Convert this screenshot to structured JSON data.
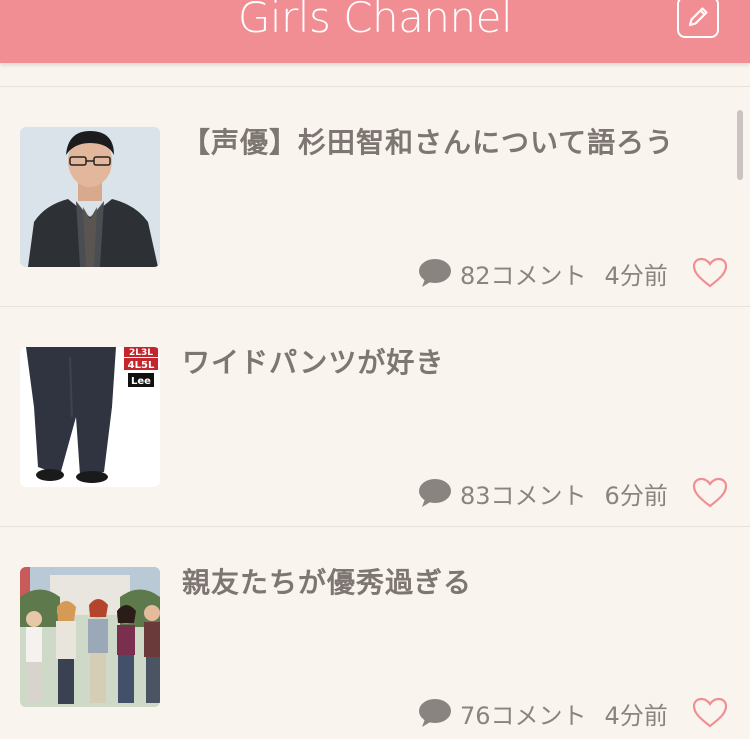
{
  "header": {
    "title": "Girls Channel",
    "edit_icon": "pencil-square-icon"
  },
  "colors": {
    "header_bg": "#f08e93",
    "page_bg": "#faf4ee",
    "title_text": "#7d7672",
    "heart": "#f08e93"
  },
  "topics": [
    {
      "title": "【声優】杉田智和さんについて語ろう",
      "comments": "82コメント",
      "time": "4分前",
      "thumb": "man-in-suit-photo"
    },
    {
      "title": "ワイドパンツが好き",
      "comments": "83コメント",
      "time": "6分前",
      "thumb": "wide-pants-photo",
      "thumb_labels": [
        "2L3L",
        "4L5L",
        "Lee"
      ]
    },
    {
      "title": "親友たちが優秀過ぎる",
      "comments": "76コメント",
      "time": "4分前",
      "thumb": "group-of-women-photo"
    }
  ]
}
